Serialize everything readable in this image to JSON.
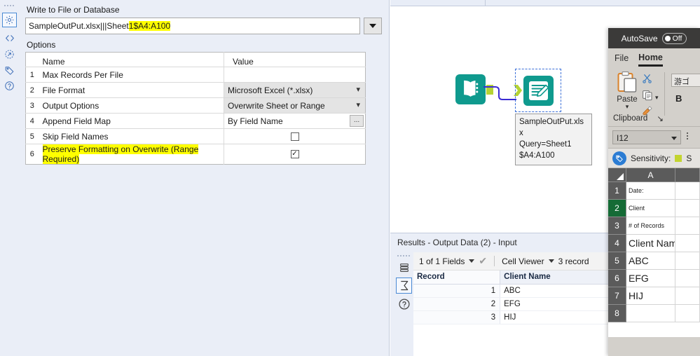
{
  "config_panel": {
    "rail_icons": [
      "drag-dots",
      "gear-icon",
      "code-icon",
      "annotation-icon",
      "tag-icon",
      "help-icon"
    ],
    "header_label": "Write to File or Database",
    "path_value_plain": "SampleOutPut.xlsx|||Sheet",
    "path_value_highlighted": "1$A4:A100 ",
    "dropdown_icon": "chevron-down-icon",
    "options_label": "Options",
    "table": {
      "headers": [
        "Name",
        "Value"
      ],
      "rows": [
        {
          "num": "1",
          "name": "Max Records Per File",
          "value": "",
          "value_type": "empty"
        },
        {
          "num": "2",
          "name": "File Format",
          "value": "Microsoft Excel (*.xlsx)",
          "value_type": "combo"
        },
        {
          "num": "3",
          "name": "Output Options",
          "value": "Overwrite Sheet or Range",
          "value_type": "combo"
        },
        {
          "num": "4",
          "name": "Append Field Map",
          "value": "By Field Name",
          "value_type": "plain-ellipsis",
          "ellipsis_label": "..."
        },
        {
          "num": "5",
          "name": "Skip Field Names",
          "value": "",
          "value_type": "checkbox",
          "checked": false
        },
        {
          "num": "6",
          "name": "Preserve Formatting on Overwrite (Range Required)",
          "value": "✓",
          "value_type": "checkbox",
          "checked": true,
          "highlighted": true
        }
      ]
    }
  },
  "canvas": {
    "input_tool_name": "input-data-tool",
    "output_tool_name": "output-data-tool",
    "tooltip_lines": [
      "SampleOutPut.xls",
      "x",
      "Query=Sheet1",
      "$A4:A100"
    ],
    "tool_color": "#0f9a8e",
    "anchor_color": "#b5d334",
    "connection_color": "#3b2bd4",
    "selection_color": "#3a6fd8"
  },
  "results": {
    "title": "Results - Output Data (2) - Input",
    "rail_icons": [
      "drag-dots",
      "layers-icon",
      "sigma-data-icon",
      "help-icon"
    ],
    "toolbar": {
      "fields_label": "1 of 1 Fields",
      "check_icon": "✔",
      "cell_viewer_label": "Cell Viewer",
      "record_count_label": "3 record"
    },
    "grid": {
      "headers": [
        "Record",
        "Client Name"
      ],
      "rows": [
        {
          "record": "1",
          "client_name": "ABC"
        },
        {
          "record": "2",
          "client_name": "EFG"
        },
        {
          "record": "3",
          "client_name": "HIJ"
        }
      ]
    }
  },
  "excel": {
    "titlebar": {
      "autosave_label": "AutoSave",
      "autosave_state": "Off"
    },
    "ribbon_tabs": [
      {
        "label": "File",
        "active": false
      },
      {
        "label": "Home",
        "active": true
      }
    ],
    "clipboard_group": {
      "paste_label": "Paste",
      "caption": "Clipboard",
      "dialog_launcher": "↘",
      "icons": [
        "paste-icon",
        "cut-scissors-icon",
        "copy-icon",
        "format-painter-icon"
      ]
    },
    "font_group": {
      "font_name": "游ゴ",
      "bold_label": "B"
    },
    "name_box": {
      "value": "I12"
    },
    "sensitivity": {
      "label": "Sensitivity:",
      "swatch_color": "#c3d42f",
      "trailing_text": "S"
    },
    "grid": {
      "columns": [
        "A",
        ""
      ],
      "selected_row": "2",
      "rows": [
        {
          "num": "1",
          "a": "Date:",
          "size": "sm"
        },
        {
          "num": "2",
          "a": "Client",
          "size": "sm"
        },
        {
          "num": "3",
          "a": "# of Records",
          "size": "sm"
        },
        {
          "num": "4",
          "a": "Client Name",
          "size": "lg"
        },
        {
          "num": "5",
          "a": "ABC",
          "size": "lg"
        },
        {
          "num": "6",
          "a": "EFG",
          "size": "lg"
        },
        {
          "num": "7",
          "a": "HIJ",
          "size": "lg"
        },
        {
          "num": "8",
          "a": "",
          "size": "sm"
        }
      ]
    }
  }
}
